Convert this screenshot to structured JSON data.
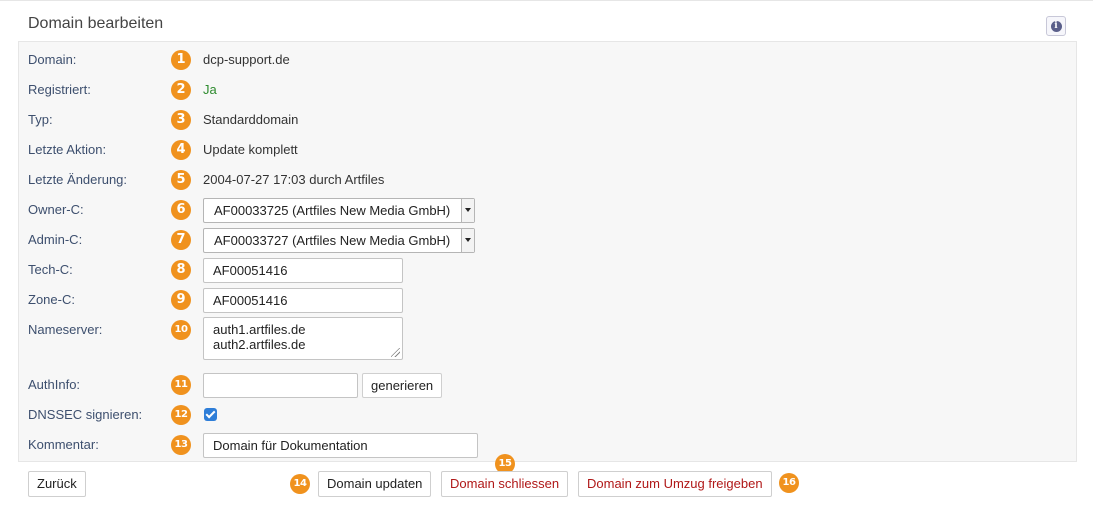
{
  "page": {
    "title": "Domain bearbeiten"
  },
  "rows": [
    {
      "badge": "1",
      "label": "Domain:",
      "value": "dcp-support.de"
    },
    {
      "badge": "2",
      "label": "Registriert:",
      "value": "Ja"
    },
    {
      "badge": "3",
      "label": "Typ:",
      "value": "Standarddomain"
    },
    {
      "badge": "4",
      "label": "Letzte Aktion:",
      "value": "Update komplett"
    },
    {
      "badge": "5",
      "label": "Letzte Änderung:",
      "value": "2004-07-27 17:03 durch Artfiles"
    },
    {
      "badge": "6",
      "label": "Owner-C:",
      "value": "AF00033725 (Artfiles New Media GmbH)"
    },
    {
      "badge": "7",
      "label": "Admin-C:",
      "value": "AF00033727 (Artfiles New Media GmbH)"
    },
    {
      "badge": "8",
      "label": "Tech-C:",
      "value": "AF00051416"
    },
    {
      "badge": "9",
      "label": "Zone-C:",
      "value": "AF00051416"
    },
    {
      "badge": "10",
      "label": "Nameserver:",
      "lines": [
        "auth1.artfiles.de",
        "auth2.artfiles.de"
      ]
    },
    {
      "badge": "11",
      "label": "AuthInfo:",
      "value": "",
      "button": "generieren"
    },
    {
      "badge": "12",
      "label": "DNSSEC signieren:",
      "checked": true
    },
    {
      "badge": "13",
      "label": "Kommentar:",
      "value": "Domain für Dokumentation"
    }
  ],
  "footer": {
    "back": "Zurück",
    "update": "Domain updaten",
    "close": "Domain schliessen",
    "transfer": "Domain zum Umzug freigeben",
    "badges": [
      "14",
      "15",
      "16"
    ]
  },
  "colors": {
    "badge": "#f0921e",
    "label": "#3d4f6e",
    "yes": "#2e8b2e",
    "danger": "#b01818"
  },
  "icons": {
    "info": "info-icon"
  }
}
